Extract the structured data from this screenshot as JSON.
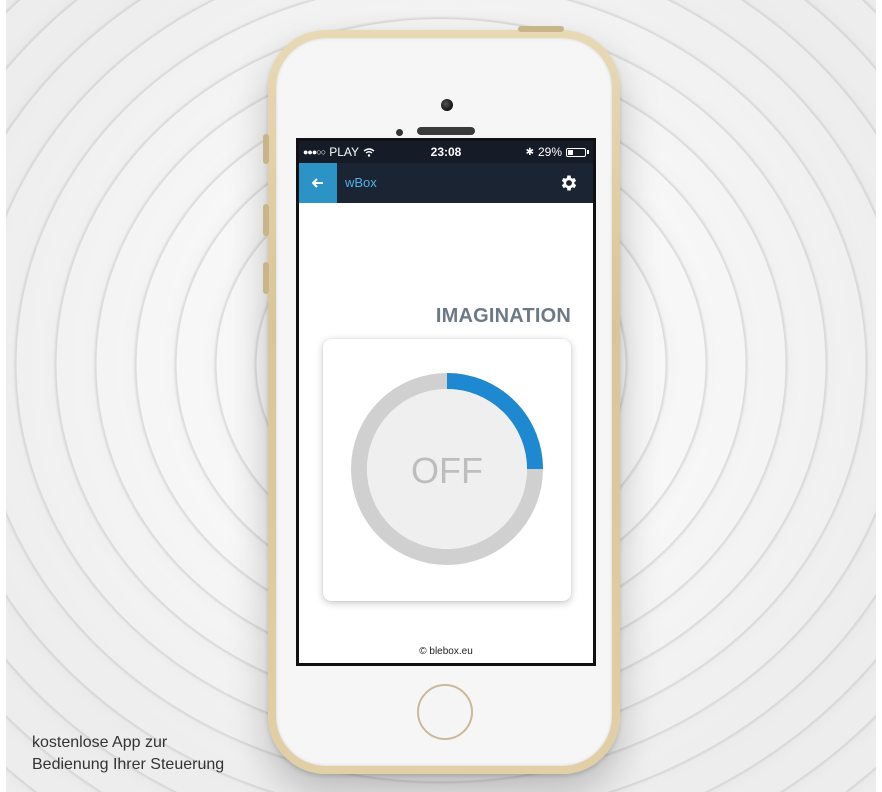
{
  "status_bar": {
    "carrier": "PLAY",
    "time": "23:08",
    "battery_percent": "29%",
    "battery_level": 0.29
  },
  "app_bar": {
    "back_icon": "back-arrow-icon",
    "title": "wBox",
    "settings_icon": "gear-icon"
  },
  "content": {
    "headline": "IMAGINATION",
    "control": {
      "state_label": "OFF",
      "level_fraction": 0.25,
      "ring_color": "#d0d0d0",
      "active_color": "#1e88d0",
      "center_color": "#efefef"
    },
    "footer": "© blebox.eu"
  },
  "caption": {
    "line1": "kostenlose App zur",
    "line2": "Bedienung Ihrer Steuerung"
  },
  "colors": {
    "app_bar_bg": "#1a2433",
    "accent": "#2c93c6",
    "title_text": "#4fb3e6"
  }
}
